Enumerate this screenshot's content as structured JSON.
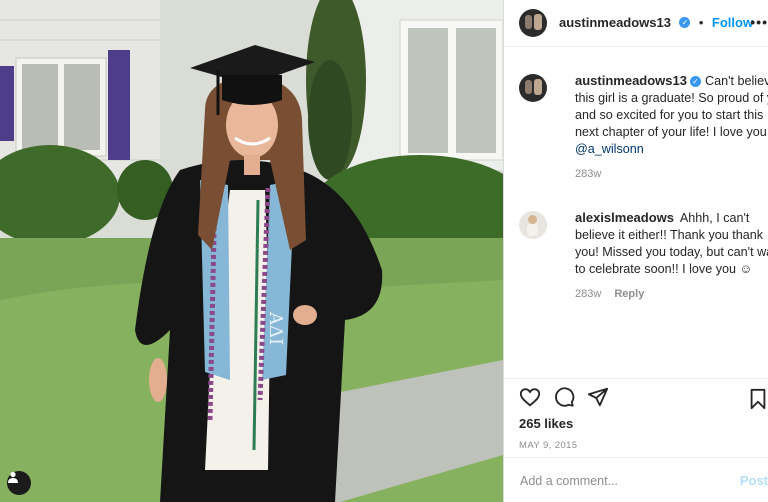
{
  "post": {
    "author": "austinmeadows13",
    "follow_label": "Follow",
    "separator": "•",
    "more_label": "•••",
    "photo_description_icon": "tag-people-icon"
  },
  "comments": [
    {
      "username": "austinmeadows13",
      "verified": true,
      "text": "Can't believe this girl is a graduate! So proud of you and so excited for you to start this next chapter of your life! I love you :)",
      "mention": "@a_wilsonn",
      "time": "283w"
    },
    {
      "username": "alexislmeadows",
      "verified": false,
      "text": "Ahhh, I can't believe it either!! Thank you thank you! Missed you today, but can't wait to celebrate soon!! I love you ☺",
      "time": "283w",
      "reply_label": "Reply"
    }
  ],
  "engagement": {
    "likes": "265 likes",
    "date": "MAY 9, 2015"
  },
  "composer": {
    "placeholder": "Add a comment...",
    "post_label": "Post"
  },
  "icons": [
    "heart-icon",
    "comment-icon",
    "share-icon",
    "bookmark-icon",
    "verified-badge-icon",
    "user-icon"
  ]
}
